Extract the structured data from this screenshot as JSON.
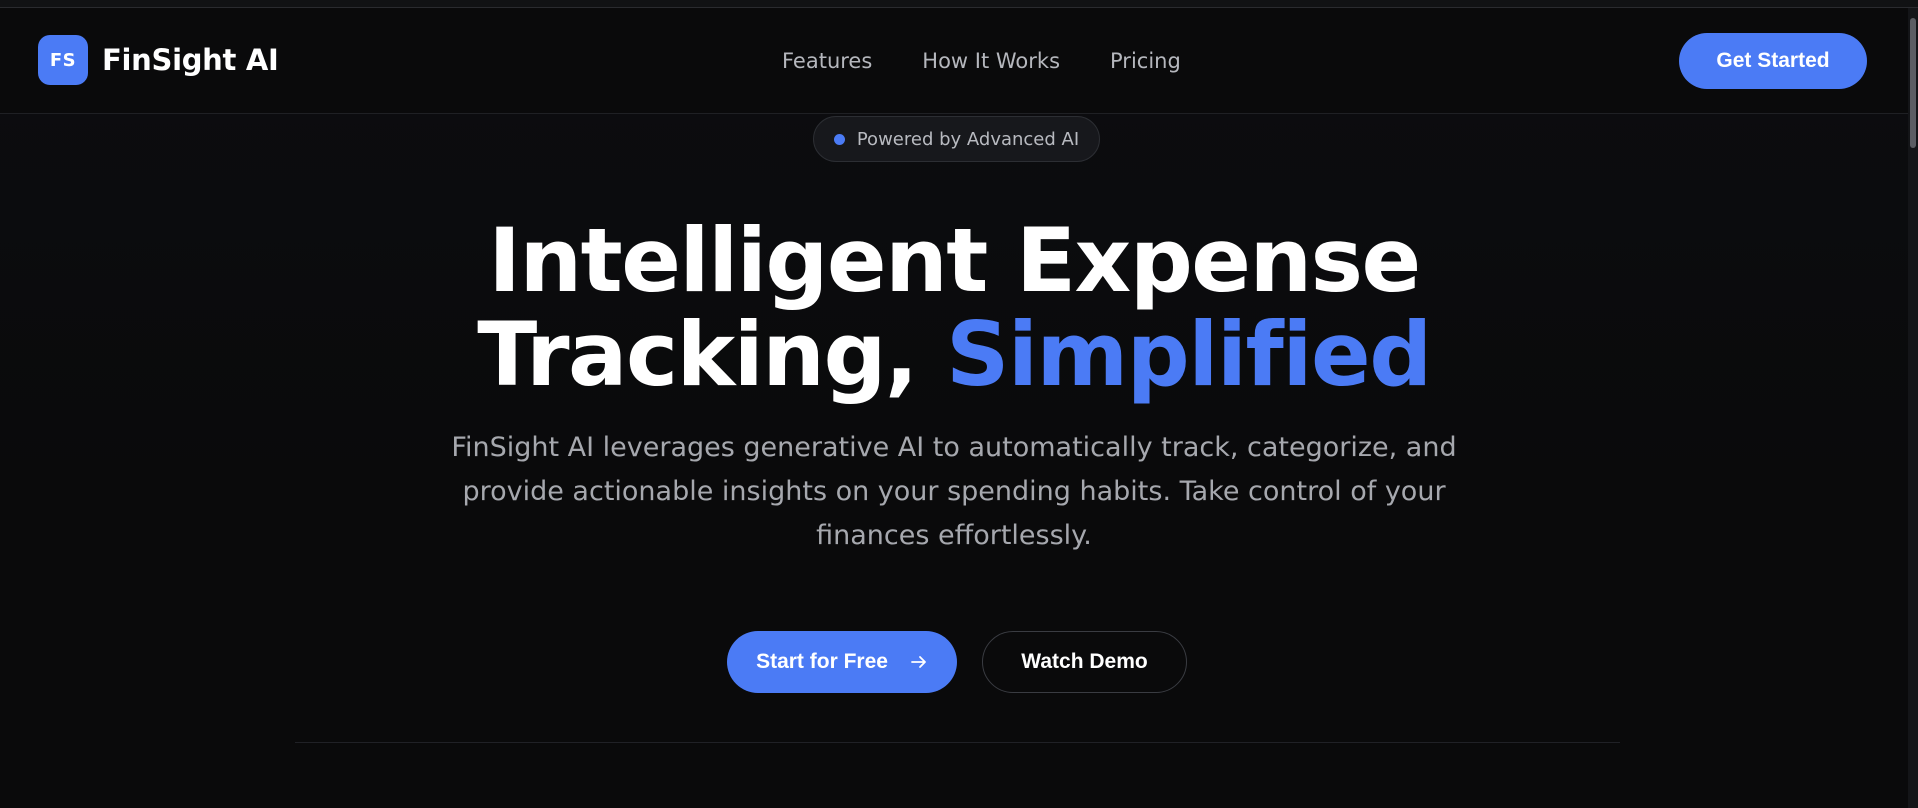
{
  "header": {
    "logo_mark": "FS",
    "brand": "FinSight AI",
    "nav": [
      "Features",
      "How It Works",
      "Pricing"
    ],
    "cta": "Get Started"
  },
  "badge": {
    "text": "Powered by Advanced AI"
  },
  "hero": {
    "title_line1": "Intelligent Expense",
    "title_line2_plain": "Tracking,",
    "title_line2_accent": "Simplified",
    "subtitle": "FinSight AI leverages generative AI to automatically track, categorize, and provide actionable insights on your spending habits. Take control of your finances effortlessly.",
    "primary_button": "Start for Free",
    "secondary_button": "Watch Demo"
  },
  "colors": {
    "accent": "#4b7bf5",
    "background": "#0a0a0b"
  },
  "icons": {
    "primary_button_icon": "arrow-right-icon"
  }
}
